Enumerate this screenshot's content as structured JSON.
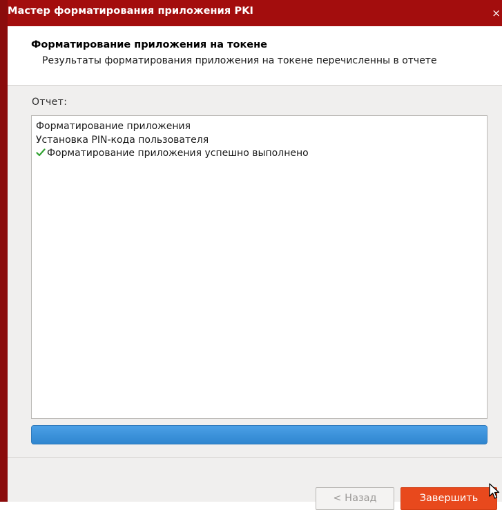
{
  "window": {
    "title": "Мастер форматирования приложения PKI",
    "close_glyph": "×"
  },
  "header": {
    "title": "Форматирование приложения на токене",
    "subtitle": "Результаты форматирования приложения на токене перечисленны в отчете"
  },
  "report": {
    "label": "Отчет:",
    "lines": [
      {
        "text": "Форматирование приложения",
        "icon": null
      },
      {
        "text": "Установка PIN-кода пользователя",
        "icon": null
      },
      {
        "text": "Форматирование приложения успешно выполнено",
        "icon": "check-icon"
      }
    ]
  },
  "progress": {
    "fraction": 1.0,
    "color": "#3a8fd6"
  },
  "buttons": {
    "back_label": "< Назад",
    "finish_label": "Завершить"
  },
  "colors": {
    "titlebar": "#a30d0d",
    "accent_button": "#e8491d",
    "check": "#2fa12f"
  }
}
